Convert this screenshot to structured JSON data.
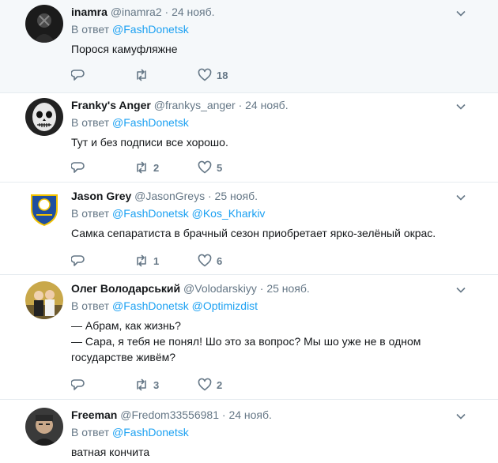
{
  "reply_prefix": "В ответ",
  "tweets": [
    {
      "name": "inamra",
      "handle": "@inamra2",
      "dot": "·",
      "time": "24 нояб.",
      "mentions": [
        "@FashDonetsk"
      ],
      "lines": [
        "Порося камуфляжне"
      ],
      "retweets": "",
      "likes": "18"
    },
    {
      "name": "Franky's Anger",
      "handle": "@frankys_anger",
      "dot": "·",
      "time": "24 нояб.",
      "mentions": [
        "@FashDonetsk"
      ],
      "lines": [
        "Тут и без подписи все хорошо."
      ],
      "retweets": "2",
      "likes": "5"
    },
    {
      "name": "Jason Grey",
      "handle": "@JasonGreys",
      "dot": "·",
      "time": "25 нояб.",
      "mentions": [
        "@FashDonetsk",
        "@Kos_Kharkiv"
      ],
      "lines": [
        "Самка сепаратиста в брачный сезон приобретает ярко-зелёный окрас."
      ],
      "retweets": "1",
      "likes": "6"
    },
    {
      "name": "Олег Володарський",
      "handle": "@Volodarskiyy",
      "dot": "·",
      "time": "25 нояб.",
      "mentions": [
        "@FashDonetsk",
        "@Optimizdist"
      ],
      "lines": [
        "— Абрам, как жизнь?",
        "— Сара, я тебя не понял! Шо это за вопрос? Мы шо уже не в одном государстве живём?"
      ],
      "retweets": "3",
      "likes": "2"
    },
    {
      "name": "Freeman",
      "handle": "@Fredom33556981",
      "dot": "·",
      "time": "24 нояб.",
      "mentions": [
        "@FashDonetsk"
      ],
      "lines": [
        "ватная кончита"
      ],
      "retweets": "",
      "likes": ""
    }
  ]
}
